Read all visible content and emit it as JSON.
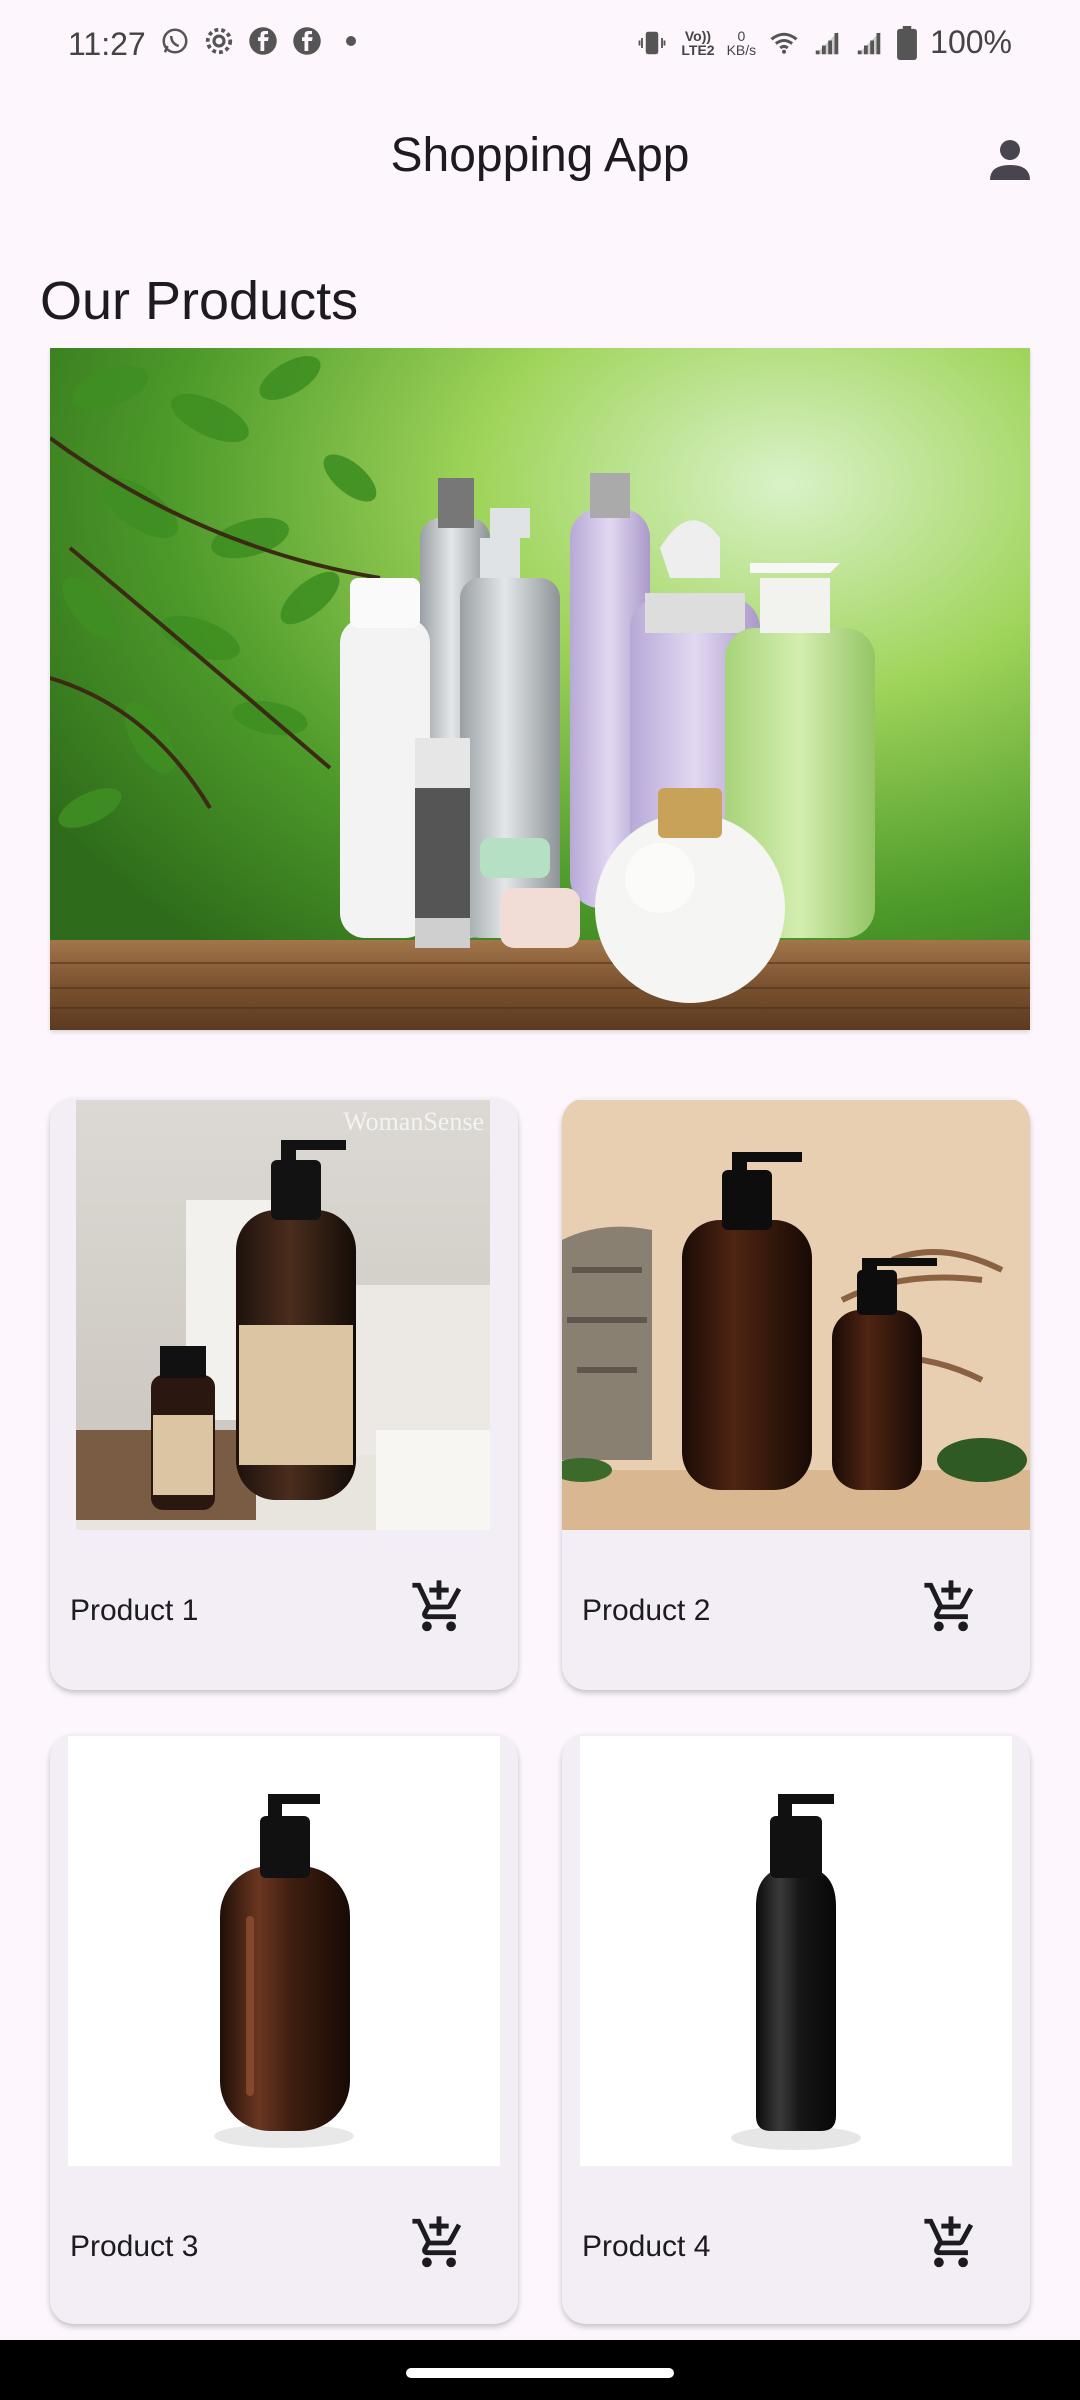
{
  "status_bar": {
    "time": "11:27",
    "left_icons": [
      "whatsapp-icon",
      "gear-icon",
      "facebook-icon",
      "facebook-icon",
      "dot-icon"
    ],
    "net_speed_value": "0",
    "net_speed_unit": "KB/s",
    "volte_label_top": "Vo))",
    "volte_label_bottom": "LTE2",
    "battery_percent": "100%"
  },
  "app_bar": {
    "title": "Shopping App",
    "account_icon": "person-icon"
  },
  "section_title": "Our Products",
  "banner": {
    "description_icon": "cosmetics-banner-image"
  },
  "products": [
    {
      "name": "Product 1",
      "watermark": "WomanSense"
    },
    {
      "name": "Product 2"
    },
    {
      "name": "Product 3"
    },
    {
      "name": "Product 4"
    }
  ],
  "colors": {
    "background": "#fdf7fd",
    "card": "#f3edf6",
    "text": "#1d1b20",
    "icon": "#444444"
  }
}
